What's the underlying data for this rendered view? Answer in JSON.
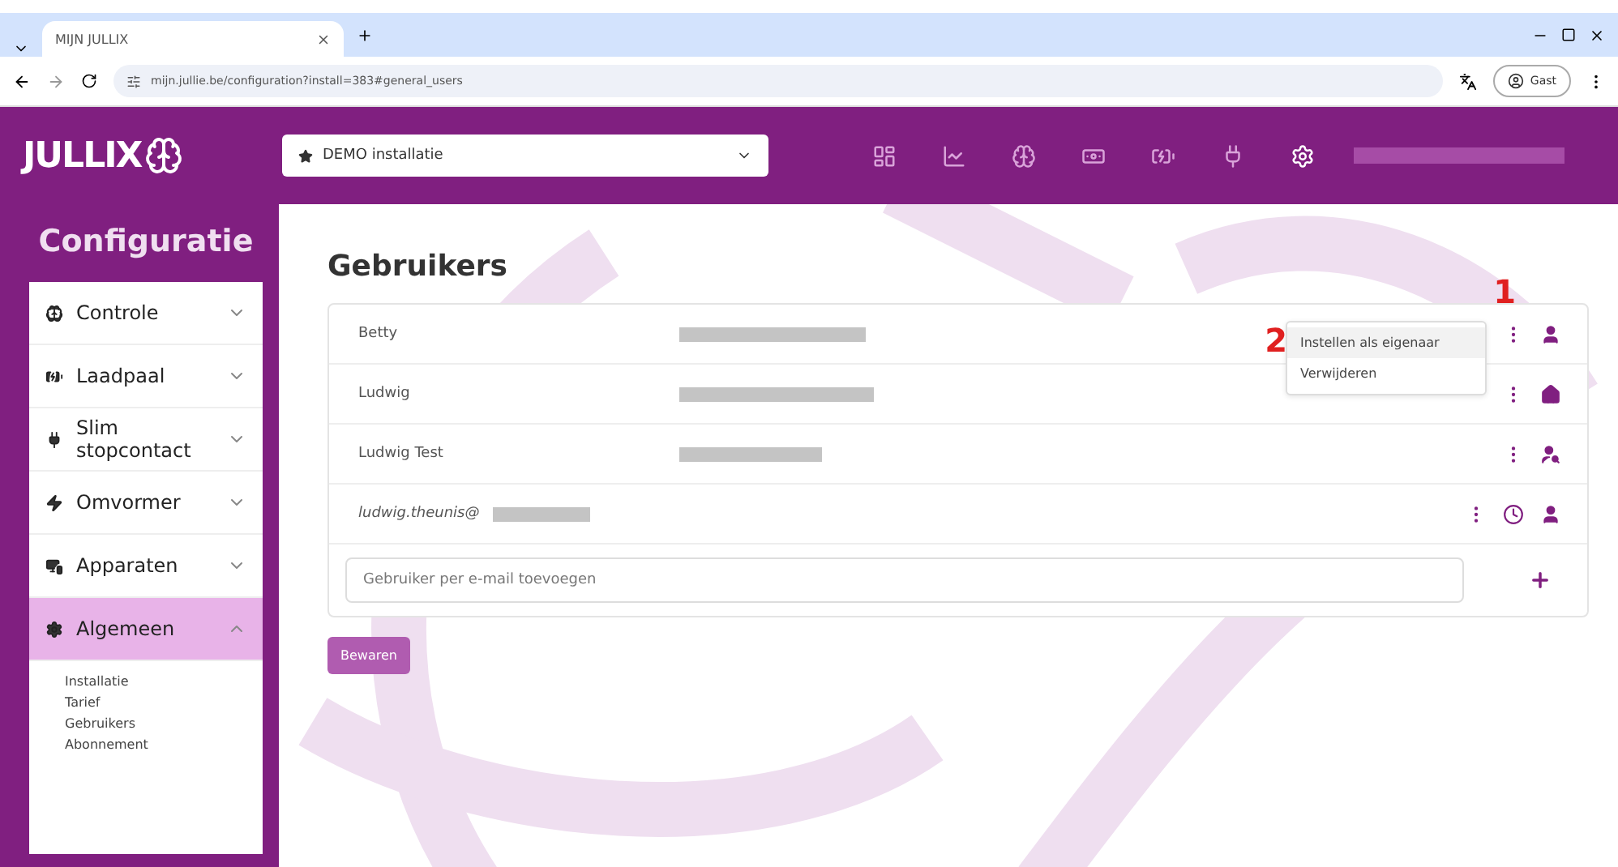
{
  "browser": {
    "tab_title": "MIJN JULLIX",
    "url": "mijn.jullie.be/configuration?install=383#general_users",
    "profile": "Gast"
  },
  "header": {
    "logo": "JULLIX",
    "installation": "DEMO installatie",
    "nav": [
      {
        "selected": false
      },
      {
        "selected": false
      },
      {
        "selected": false
      },
      {
        "selected": false
      },
      {
        "selected": false
      },
      {
        "selected": false
      },
      {
        "selected": true
      }
    ]
  },
  "sidebar": {
    "title": "Configuratie",
    "items": [
      {
        "label": "Controle",
        "expanded": false
      },
      {
        "label": "Laadpaal",
        "expanded": false
      },
      {
        "label": "Slim stopcontact",
        "expanded": false
      },
      {
        "label": "Omvormer",
        "expanded": false
      },
      {
        "label": "Apparaten",
        "expanded": false
      },
      {
        "label": "Algemeen",
        "expanded": true,
        "children": [
          "Installatie",
          "Tarief",
          "Gebruikers",
          "Abonnement"
        ]
      }
    ]
  },
  "main": {
    "title": "Gebruikers",
    "users": [
      {
        "name": "Betty",
        "kind": "user",
        "pending": false,
        "italic": false
      },
      {
        "name": "Ludwig",
        "kind": "owner",
        "pending": false,
        "italic": false
      },
      {
        "name": "Ludwig Test",
        "kind": "admin",
        "pending": false,
        "italic": false
      },
      {
        "name": "ludwig.theunis@",
        "kind": "user",
        "pending": true,
        "italic": true
      }
    ],
    "add_placeholder": "Gebruiker per e-mail toevoegen",
    "save_button": "Bewaren"
  },
  "menu": {
    "items": [
      {
        "label": "Instellen als eigenaar",
        "selected": true
      },
      {
        "label": "Verwijderen",
        "selected": false
      }
    ]
  },
  "annotations": [
    "1",
    "2"
  ]
}
